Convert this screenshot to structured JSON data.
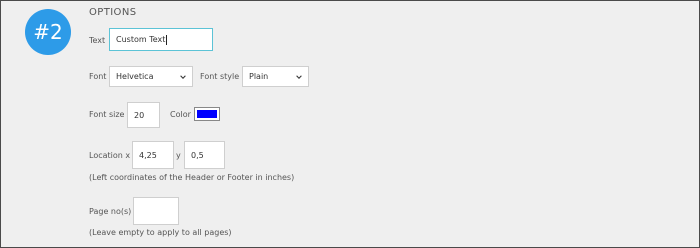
{
  "step": {
    "label": "#2"
  },
  "section": {
    "title": "OPTIONS"
  },
  "text": {
    "label": "Text",
    "value": "Custom Text"
  },
  "font": {
    "label": "Font",
    "selected": "Helvetica"
  },
  "font_style": {
    "label": "Font style",
    "selected": "Plain"
  },
  "font_size": {
    "label": "Font size",
    "value": "20"
  },
  "color": {
    "label": "Color",
    "value": "#0000ff"
  },
  "location": {
    "label": "Location x",
    "x_value": "4,25",
    "y_label": "y",
    "y_value": "0,5",
    "hint": "(Left coordinates of the Header or Footer in inches)"
  },
  "pages": {
    "label": "Page no(s)",
    "value": "",
    "hint": "(Leave empty to apply to all pages)"
  },
  "colors": {
    "accent": "#2d9be8",
    "focus_border": "#5cc3d6"
  }
}
